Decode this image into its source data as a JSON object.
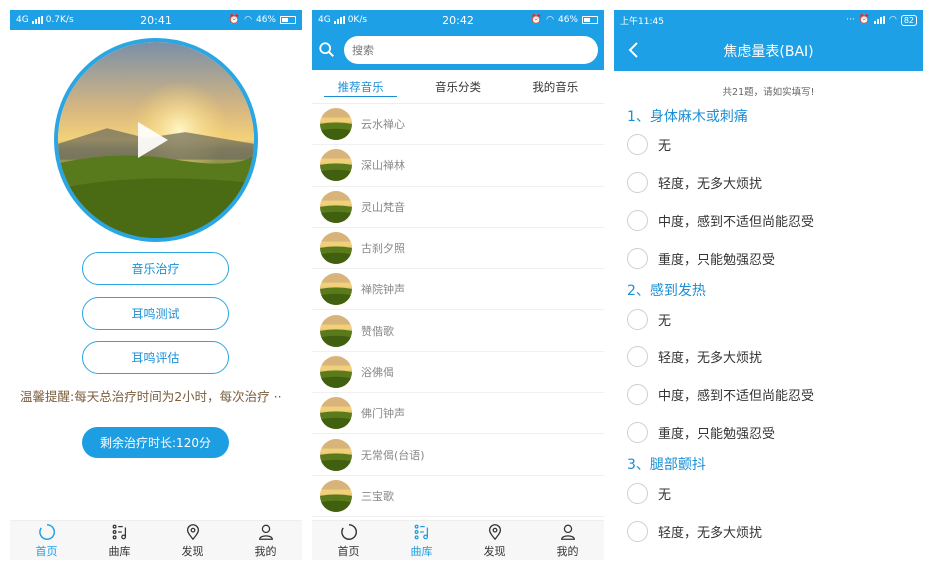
{
  "screens": [
    {
      "status": {
        "network": "4G",
        "speed": "0.7K/s",
        "time": "20:41",
        "battery": "46%"
      },
      "buttons": {
        "music_therapy": "音乐治疗",
        "tinnitus_test": "耳鸣测试",
        "tinnitus_eval": "耳鸣评估"
      },
      "notice": "温馨提醒:每天总治疗时间为2小时，每次治疗 ··",
      "remaining": "剩余治疗时长:120分",
      "tabs": [
        "首页",
        "曲库",
        "发现",
        "我的"
      ]
    },
    {
      "status": {
        "network": "4G",
        "speed": "0K/s",
        "time": "20:42",
        "battery": "46%"
      },
      "search_placeholder": "搜索",
      "top_tabs": [
        "推荐音乐",
        "音乐分类",
        "我的音乐"
      ],
      "songs": [
        "云水禅心",
        "深山禅林",
        "灵山梵音",
        "古刹夕照",
        "禅院钟声",
        "赞偕歌",
        "浴佛偈",
        "佛门钟声",
        "无常偈(台语)",
        "三宝歌"
      ],
      "tabs": [
        "首页",
        "曲库",
        "发现",
        "我的"
      ]
    },
    {
      "status": {
        "time": "上午11:45",
        "battery": "82"
      },
      "title": "焦虑量表(BAI)",
      "hint": "共21题，请如实填写!",
      "questions": [
        {
          "title": "1、身体麻木或刺痛",
          "options": [
            "无",
            "轻度，无多大烦扰",
            "中度，感到不适但尚能忍受",
            "重度，只能勉强忍受"
          ]
        },
        {
          "title": "2、感到发热",
          "options": [
            "无",
            "轻度，无多大烦扰",
            "中度，感到不适但尚能忍受",
            "重度，只能勉强忍受"
          ]
        },
        {
          "title": "3、腿部颤抖",
          "options": [
            "无",
            "轻度，无多大烦扰"
          ]
        }
      ]
    }
  ],
  "colors": {
    "accent": "#1ea0e6",
    "notice_text": "#7a5c3c"
  },
  "icons": {
    "home": "spinner-ring-icon",
    "library": "music-list-icon",
    "discover": "location-pin-icon",
    "mine": "person-icon",
    "search": "search-icon",
    "back": "chevron-left-icon"
  }
}
